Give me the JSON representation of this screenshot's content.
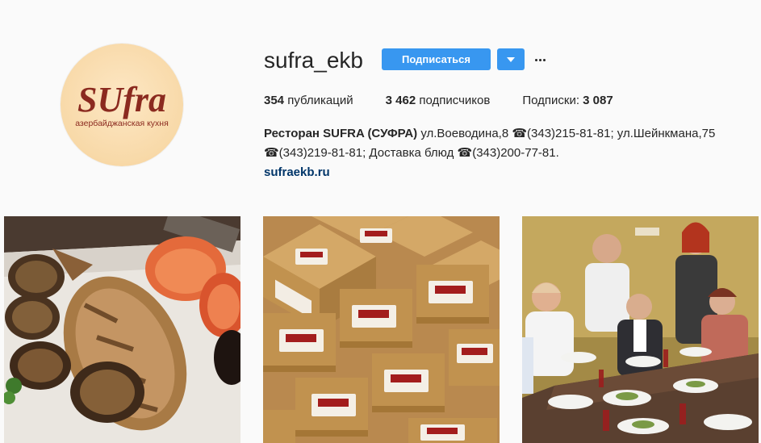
{
  "profile": {
    "username": "sufra_ekb",
    "follow_label": "Подписаться",
    "avatar_logo_text": "SUfra",
    "avatar_logo_subtitle": "азербайджанская кухня"
  },
  "stats": {
    "posts_count": "354",
    "posts_label": "публикаций",
    "followers_count": "3 462",
    "followers_label": "подписчиков",
    "following_label": "Подписки:",
    "following_count": "3 087"
  },
  "bio": {
    "name": "Ресторан SUFRA (СУФРА)",
    "line1": " ул.Воеводина,8 ☎(343)215-81-81; ул.Шейнкмана,75",
    "line2": "☎(343)219-81-81; Доставка блюд ☎(343)200-77-81.",
    "website": "sufraekb.ru"
  },
  "posts": [
    {
      "id": "post-fish",
      "subject": "grilled fish with eggplant and tomato"
    },
    {
      "id": "post-boxes",
      "subject": "stacked delivery boxes with sufra logo"
    },
    {
      "id": "post-guests",
      "subject": "group of guests at restaurant table"
    }
  ],
  "colors": {
    "accent": "#3897f0",
    "link": "#003569",
    "logo_red": "#8b2a1f",
    "background": "#fafafa"
  }
}
